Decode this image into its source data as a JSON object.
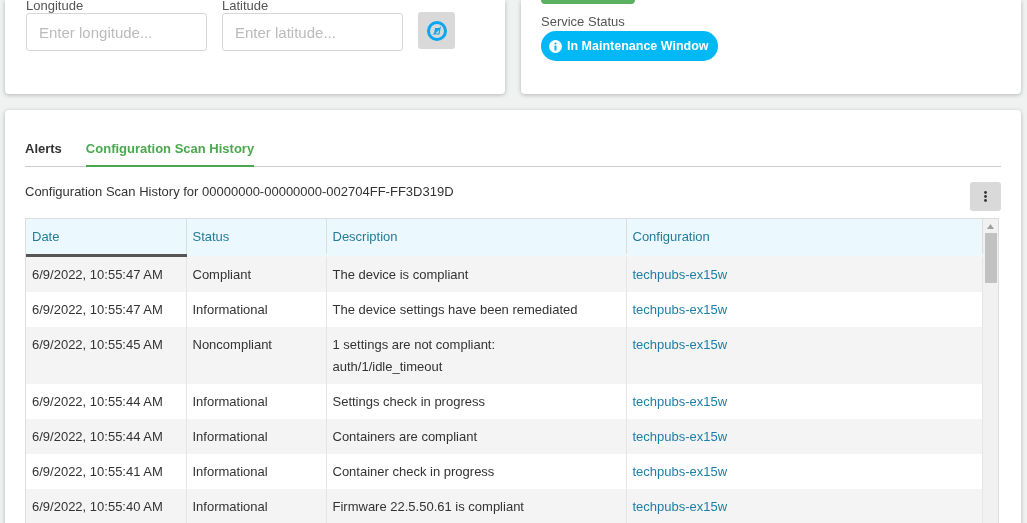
{
  "location": {
    "longitude": {
      "label": "Longitude",
      "placeholder": "Enter longitude..."
    },
    "latitude": {
      "label": "Latitude",
      "placeholder": "Enter latitude..."
    }
  },
  "service": {
    "label": "Service Status",
    "badge": "In Maintenance Window"
  },
  "tabs": [
    {
      "label": "Alerts",
      "selected": false
    },
    {
      "label": "Configuration Scan History",
      "selected": true
    }
  ],
  "history": {
    "title": "Configuration Scan History for 00000000-00000000-002704FF-FF3D319D",
    "columns": [
      {
        "label": "Date",
        "sorted": true
      },
      {
        "label": "Status",
        "sorted": false
      },
      {
        "label": "Description",
        "sorted": false
      },
      {
        "label": "Configuration",
        "sorted": false
      }
    ],
    "rows": [
      {
        "date": "6/9/2022, 10:55:47 AM",
        "status": "Compliant",
        "description": [
          "The device is compliant"
        ],
        "configuration": "techpubs-ex15w"
      },
      {
        "date": "6/9/2022, 10:55:47 AM",
        "status": "Informational",
        "description": [
          "The device settings have been remediated"
        ],
        "configuration": "techpubs-ex15w"
      },
      {
        "date": "6/9/2022, 10:55:45 AM",
        "status": "Noncompliant",
        "description": [
          "1 settings are not compliant:",
          "auth/1/idle_timeout"
        ],
        "configuration": "techpubs-ex15w"
      },
      {
        "date": "6/9/2022, 10:55:44 AM",
        "status": "Informational",
        "description": [
          "Settings check in progress"
        ],
        "configuration": "techpubs-ex15w"
      },
      {
        "date": "6/9/2022, 10:55:44 AM",
        "status": "Informational",
        "description": [
          "Containers are compliant"
        ],
        "configuration": "techpubs-ex15w"
      },
      {
        "date": "6/9/2022, 10:55:41 AM",
        "status": "Informational",
        "description": [
          "Container check in progress"
        ],
        "configuration": "techpubs-ex15w"
      },
      {
        "date": "6/9/2022, 10:55:40 AM",
        "status": "Informational",
        "description": [
          "Firmware 22.5.50.61 is compliant"
        ],
        "configuration": "techpubs-ex15w"
      }
    ]
  }
}
